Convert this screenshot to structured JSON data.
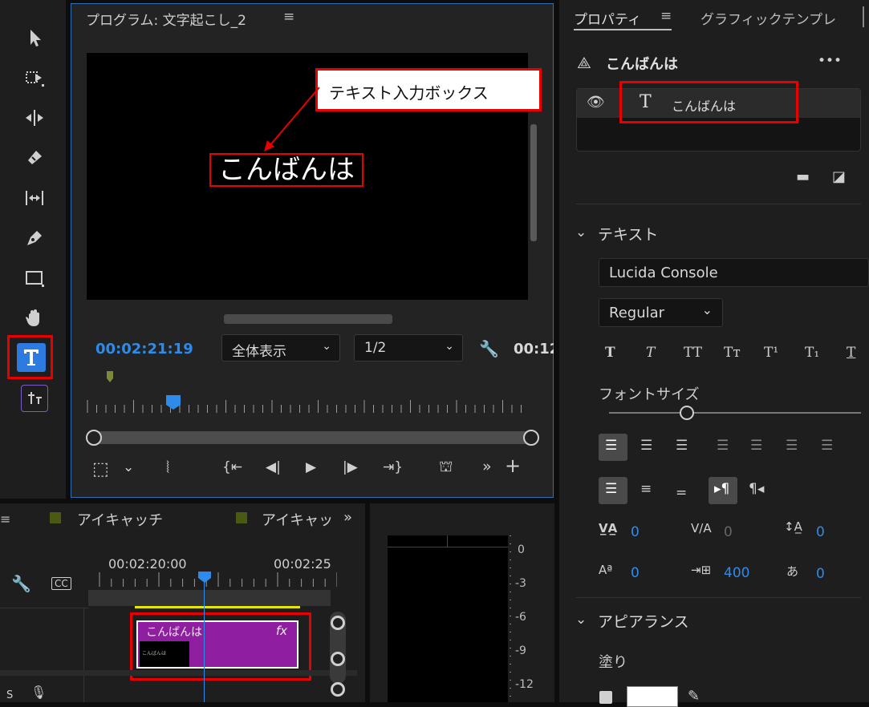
{
  "program": {
    "title": "プログラム: 文字起こし_2",
    "menu_icon": "≡",
    "callout": "テキスト入力ボックス",
    "canvas_text": "こんばんは",
    "timecode": "00:02:21:19",
    "zoom": "全体表示",
    "resolution": "1/2",
    "duration_partial": "00:12"
  },
  "properties": {
    "tab_active": "プロパティ",
    "tab_menu": "≡",
    "tab_other": "グラフィックテンプレ",
    "layer_name": "こんばんは",
    "more": "•••",
    "layer_item": "こんばんは",
    "text_section": "テキスト",
    "font": "Lucida Console",
    "style": "Regular",
    "font_size_label": "フォントサイズ",
    "kerning": "0",
    "tracking_vert": "0",
    "leading": "0",
    "baseline": "0",
    "tracking": "400",
    "tsume": "0",
    "appearance_section": "アピアランス",
    "fill_label": "塗り"
  },
  "timeline": {
    "tab1": "アイキャッチ",
    "tab2": "アイキャッ",
    "tc1": "00:02:20:00",
    "tc2": "00:02:25",
    "clip_name": "こんばんは",
    "clip_fx": "fx",
    "thumb_text": "こんばんは",
    "track_s": "S"
  },
  "meter": {
    "labels": [
      "0",
      "-3",
      "-6",
      "-9",
      "-12"
    ]
  },
  "colors": {
    "accent_blue": "#2d8ceb",
    "highlight_red": "#e60000",
    "clip_purple": "#8f1fa0",
    "panel_bg": "#1e1e1e"
  }
}
